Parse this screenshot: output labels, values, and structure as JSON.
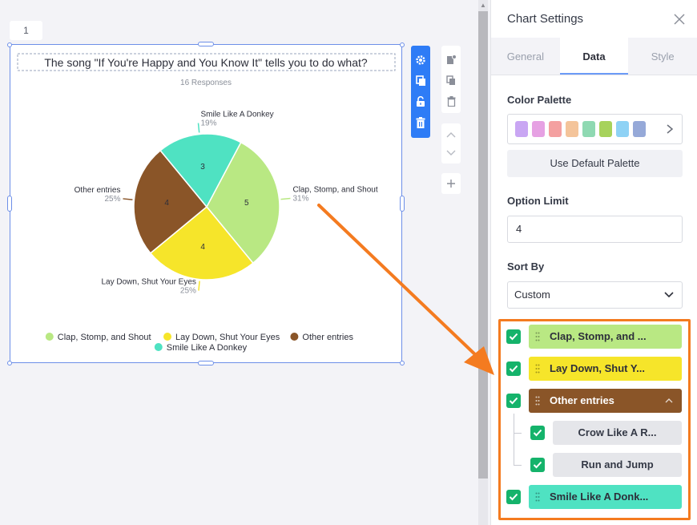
{
  "page_tab": {
    "label": "1"
  },
  "chart": {
    "title": "The song \"If You're Happy and You Know It\" tells you to do what?",
    "subtitle": "16 Responses"
  },
  "chart_data": {
    "type": "pie",
    "title": "The song \"If You're Happy and You Know It\" tells you to do what?",
    "subtitle": "16 Responses",
    "categories": [
      "Clap, Stomp, and Shout",
      "Lay Down, Shut Your Eyes",
      "Other entries",
      "Smile Like A Donkey"
    ],
    "values": [
      5,
      4,
      4,
      3
    ],
    "percent_labels": [
      "31%",
      "25%",
      "25%",
      "19%"
    ],
    "colors": [
      "#b9e883",
      "#f6e52a",
      "#8a5528",
      "#4fe2c2"
    ],
    "legend_position": "bottom"
  },
  "panel": {
    "title": "Chart Settings",
    "tabs": [
      {
        "label": "General",
        "active": false
      },
      {
        "label": "Data",
        "active": true
      },
      {
        "label": "Style",
        "active": false
      }
    ],
    "color_palette_label": "Color Palette",
    "palette_swatches": [
      "#c9a6f3",
      "#e6a1e3",
      "#f4a0a0",
      "#f4c49a",
      "#8fd9b2",
      "#a7d25b",
      "#8ed2f5",
      "#96a9d8"
    ],
    "default_palette_label": "Use Default Palette",
    "option_limit_label": "Option Limit",
    "option_limit_value": "4",
    "sort_by_label": "Sort By",
    "sort_by_value": "Custom"
  },
  "options": [
    {
      "label": "Clap, Stomp, and ...",
      "color": "#b9e883",
      "text_color": "#2d2f3a"
    },
    {
      "label": "Lay Down, Shut Y...",
      "color": "#f6e52a",
      "text_color": "#2d2f3a"
    },
    {
      "label": "Other entries",
      "color": "#8a5528",
      "text_color": "#ffffff"
    },
    {
      "label": "Smile Like A Donk...",
      "color": "#4fe2c2",
      "text_color": "#2d2f3a"
    }
  ],
  "sub_options": [
    {
      "label": "Crow Like A R..."
    },
    {
      "label": "Run and Jump"
    }
  ]
}
